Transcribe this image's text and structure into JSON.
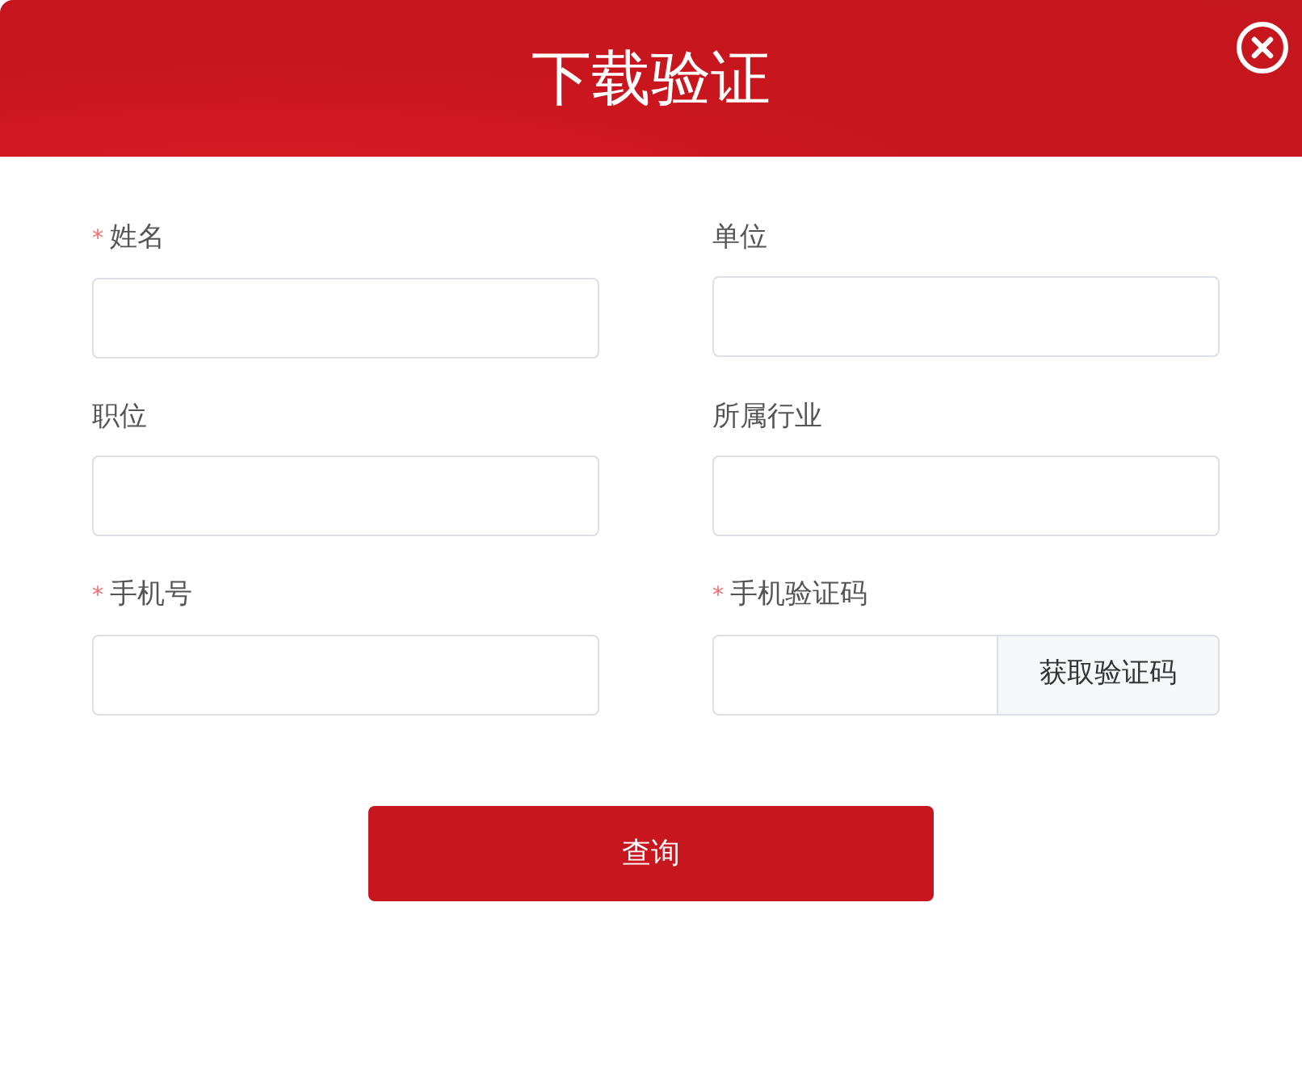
{
  "dialog": {
    "title": "下载验证"
  },
  "fields": [
    {
      "kind": "text",
      "label": "姓名",
      "required_mark": "*"
    },
    {
      "kind": "text",
      "label": "单位"
    },
    {
      "kind": "text",
      "label": "职位"
    },
    {
      "kind": "text",
      "label": "所属行业"
    },
    {
      "kind": "text",
      "label": "手机号",
      "required_mark": "*"
    },
    {
      "kind": "code",
      "label": "手机验证码",
      "required_mark": "*",
      "button": "获取验证码"
    }
  ],
  "submit": "查询"
}
